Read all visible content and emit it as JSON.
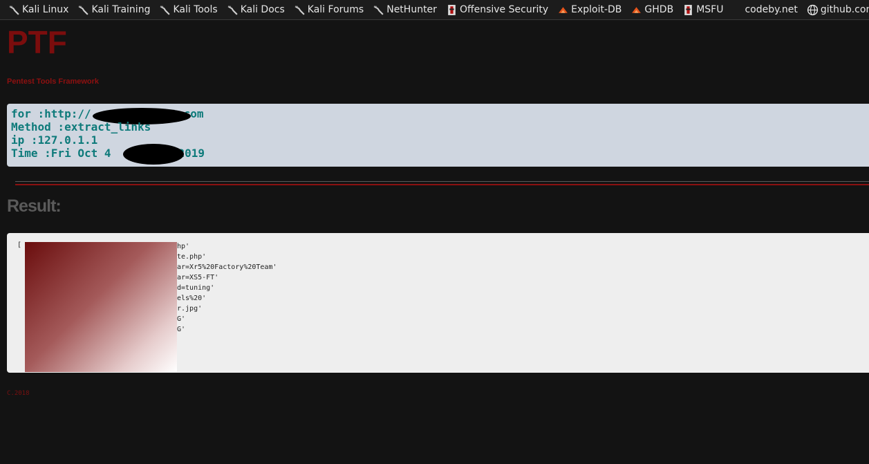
{
  "bookmarks": [
    {
      "label": "Kali Linux",
      "icon": "kali-dragon-icon"
    },
    {
      "label": "Kali Training",
      "icon": "kali-dragon-icon"
    },
    {
      "label": "Kali Tools",
      "icon": "kali-dragon-icon"
    },
    {
      "label": "Kali Docs",
      "icon": "kali-dragon-icon"
    },
    {
      "label": "Kali Forums",
      "icon": "kali-dragon-icon"
    },
    {
      "label": "NetHunter",
      "icon": "kali-dragon-icon"
    },
    {
      "label": "Offensive Security",
      "icon": "offsec-icon"
    },
    {
      "label": "Exploit-DB",
      "icon": "exploit-db-icon"
    },
    {
      "label": "GHDB",
      "icon": "exploit-db-icon"
    },
    {
      "label": "MSFU",
      "icon": "offsec-icon"
    },
    {
      "label": "codeby.net",
      "icon": ""
    },
    {
      "label": "github.com",
      "icon": "globe-icon"
    }
  ],
  "header": {
    "title": "PTF",
    "subtitle": "Pentest Tools Framework"
  },
  "info": {
    "for_line": "for :http://",
    "for_suffix": "com",
    "method_line": "Method :extract_links",
    "ip_line": "ip :127.0.1.1",
    "time_line": "Time :Fri Oct 4",
    "time_suffix": "2019"
  },
  "result": {
    "heading": "Result:",
    "open_bracket": "[",
    "lines": [
      "hp'",
      "te.php'",
      "ar=Xr5%20Factory%20Team'",
      "ar=XS5-FT'",
      "d=tuning'",
      "els%20'",
      "r.jpg'",
      "G'",
      "G'"
    ]
  },
  "footer": {
    "text": "C.2018"
  },
  "colors": {
    "background": "#131313",
    "accent_red": "#7b0d0d",
    "info_text": "#0d7a7a",
    "info_box": "#cfd6e0",
    "result_box": "#eeeeee"
  }
}
